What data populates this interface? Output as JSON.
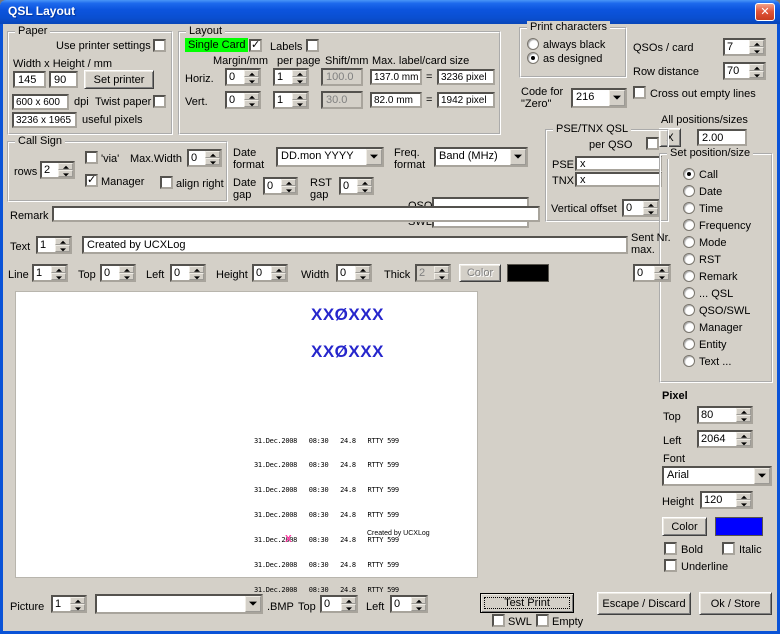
{
  "window": {
    "title": "QSL Layout"
  },
  "paper": {
    "title": "Paper",
    "use_printer_settings_label": "Use printer settings",
    "use_printer_settings_checked": false,
    "wh_label": "Width x Height / mm",
    "width": "145",
    "height": "90",
    "set_printer_label": "Set printer",
    "dpi_value": "600 x 600",
    "dpi_label": "dpi",
    "twist_label": "Twist paper",
    "twist_checked": false,
    "useful_value": "3236 x 1965",
    "useful_label": "useful pixels"
  },
  "layout": {
    "title": "Layout",
    "single_card_label": "Single Card",
    "single_card_checked": true,
    "single_card_bg": "#00ff00",
    "labels_label": "Labels",
    "labels_checked": false,
    "col_margin": "Margin/mm",
    "col_per_page": "per page",
    "col_shift": "Shift/mm",
    "col_max": "Max. label/card size",
    "horiz_label": "Horiz.",
    "vert_label": "Vert.",
    "horiz_margin": "0",
    "horiz_per_page": "1",
    "horiz_shift": "100.0",
    "vert_margin": "0",
    "vert_per_page": "1",
    "vert_shift": "30.0",
    "max_w_mm": "137.0 mm",
    "eq1": "=",
    "max_w_px": "3236 pixel",
    "max_h_mm": "82.0 mm",
    "eq2": "=",
    "max_h_px": "1942 pixel"
  },
  "print_chars": {
    "title": "Print characters",
    "always_black_label": "always black",
    "always_black_selected": false,
    "as_designed_label": "as designed",
    "as_designed_selected": true
  },
  "qsos": {
    "qsos_card_label": "QSOs / card",
    "qsos_card_value": "7",
    "row_distance_label": "Row distance",
    "row_distance_value": "70",
    "cross_out_label": "Cross out empty lines",
    "cross_out_checked": false
  },
  "code_zero": {
    "label": "Code for \"Zero\"",
    "value": "216"
  },
  "all_pos": {
    "label": "All positions/sizes",
    "x_label": "X",
    "value": "2.00"
  },
  "call_sign": {
    "title": "Call Sign",
    "rows_label": "rows",
    "rows_value": "2",
    "via_label": "'via'",
    "via_checked": false,
    "max_width_label": "Max.Width",
    "max_width_value": "0",
    "manager_label": "Manager",
    "manager_checked": true,
    "align_right_label": "align right",
    "align_right_checked": false
  },
  "formats": {
    "date_format_label": "Date format",
    "date_format_value": "DD.mon YYYY",
    "freq_format_label": "Freq. format",
    "freq_format_value": "Band (MHz)",
    "date_gap_label": "Date gap",
    "date_gap_value": "0",
    "rst_gap_label": "RST gap",
    "rst_gap_value": "0",
    "qso_label": "QSO",
    "qso_value": "",
    "swl_label": "SWL",
    "swl_value": ""
  },
  "pse_tnx": {
    "title": "PSE/TNX QSL",
    "per_qso_label": "per QSO",
    "per_qso_checked": false,
    "pse_label": "PSE",
    "pse_value": "x",
    "tnx_label": "TNX",
    "tnx_value": "x",
    "vertical_offset_label": "Vertical offset",
    "vertical_offset_value": "0"
  },
  "set_pos": {
    "title": "Set position/size",
    "items": [
      {
        "label": "Call",
        "selected": true
      },
      {
        "label": "Date",
        "selected": false
      },
      {
        "label": "Time",
        "selected": false
      },
      {
        "label": "Frequency",
        "selected": false
      },
      {
        "label": "Mode",
        "selected": false
      },
      {
        "label": "RST",
        "selected": false
      },
      {
        "label": "Remark",
        "selected": false
      },
      {
        "label": "... QSL",
        "selected": false
      },
      {
        "label": "QSO/SWL",
        "selected": false
      },
      {
        "label": "Manager",
        "selected": false
      },
      {
        "label": "Entity",
        "selected": false
      },
      {
        "label": "Text ...",
        "selected": false
      }
    ]
  },
  "remark": {
    "label": "Remark",
    "value": ""
  },
  "text_row": {
    "label": "Text",
    "index": "1",
    "value": "Created by UCXLog"
  },
  "sent_nr": {
    "label": "Sent Nr. max.",
    "value": "0"
  },
  "line_row": {
    "label": "Line",
    "index": "1",
    "top_label": "Top",
    "top": "0",
    "left_label": "Left",
    "left": "0",
    "height_label": "Height",
    "height": "0",
    "width_label": "Width",
    "width": "0",
    "thick_label": "Thick",
    "thick": "2",
    "color_label": "Color",
    "color_value": "#000000"
  },
  "preview": {
    "call1": "XXØXXX",
    "call2": "XXØXXX",
    "call_color": "#2626cc",
    "qso_rows": [
      "31.Dec.2008   08:30   24.8   RTTY 599",
      "31.Dec.2008   08:30   24.8   RTTY 599",
      "31.Dec.2008   08:30   24.8   RTTY 599",
      "31.Dec.2008   08:30   24.8   RTTY 599",
      "31.Dec.2008   08:30   24.8   RTTY 599",
      "31.Dec.2008   08:30   24.8   RTTY 599",
      "31.Dec.2008   08:30   24.8   RTTY 599"
    ],
    "x_mark": "X",
    "x_color": "#ff35a2",
    "credit": "Created by UCXLog"
  },
  "pixel": {
    "title": "Pixel",
    "top_label": "Top",
    "top": "80",
    "left_label": "Left",
    "left": "2064",
    "font_label": "Font",
    "font_value": "Arial",
    "height_label": "Height",
    "height": "120",
    "color_label": "Color",
    "color_value": "#0000ff",
    "bold_label": "Bold",
    "bold_checked": false,
    "italic_label": "Italic",
    "italic_checked": false,
    "underline_label": "Underline",
    "underline_checked": false
  },
  "bottom": {
    "picture_label": "Picture",
    "picture_index": "1",
    "picture_value": "",
    "bmp_label": ".BMP",
    "top_label": "Top",
    "top": "0",
    "left_label": "Left",
    "left": "0",
    "test_print_label": "Test Print",
    "swl_label": "SWL",
    "swl_checked": false,
    "empty_label": "Empty",
    "empty_checked": false,
    "escape_label": "Escape / Discard",
    "ok_label": "Ok / Store"
  }
}
